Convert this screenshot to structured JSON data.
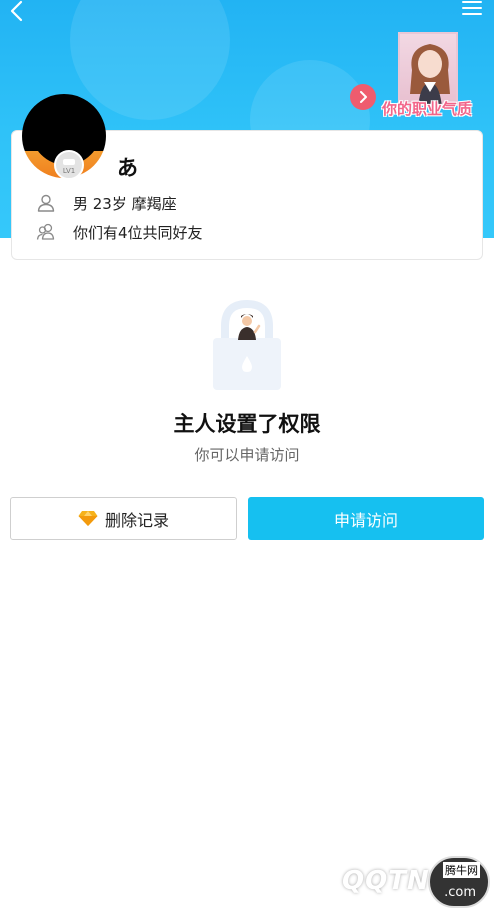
{
  "header": {
    "back_icon": "chevron-left-icon",
    "menu_icon": "hamburger-menu-icon",
    "ad_text": "你的职业气质"
  },
  "profile": {
    "username": "あ",
    "level_badge": "LV1",
    "info": [
      {
        "icon": "person-icon",
        "text": "男 23岁 摩羯座"
      },
      {
        "icon": "friends-icon",
        "text": "你们有4位共同好友"
      }
    ]
  },
  "permission": {
    "title": "主人设置了权限",
    "subtitle": "你可以申请访问"
  },
  "actions": {
    "delete_label": "删除记录",
    "request_label": "申请访问"
  },
  "watermark": {
    "brand": "QQTN",
    "site_name": "腾牛网",
    "suffix": ".com"
  },
  "colors": {
    "header_blue": "#2fc2f8",
    "primary_button": "#16c0f0",
    "ad_text_pink": "#f2668a",
    "avatar_ring_orange": "#f39b2e"
  }
}
